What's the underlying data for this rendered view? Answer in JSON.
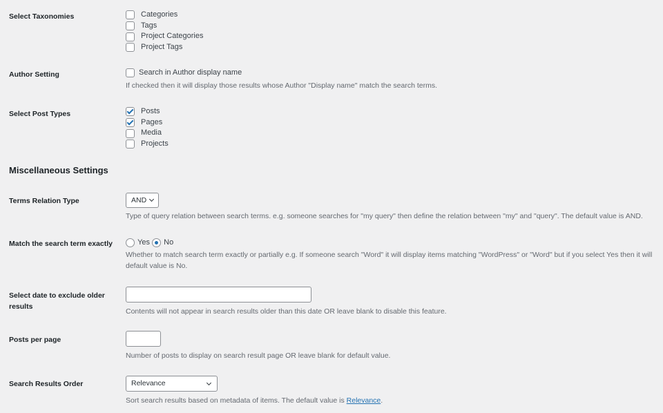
{
  "taxonomies": {
    "label": "Select Taxonomies",
    "options": [
      {
        "label": "Categories",
        "checked": false
      },
      {
        "label": "Tags",
        "checked": false
      },
      {
        "label": "Project Categories",
        "checked": false
      },
      {
        "label": "Project Tags",
        "checked": false
      }
    ]
  },
  "author": {
    "label": "Author Setting",
    "option": {
      "label": "Search in Author display name",
      "checked": false
    },
    "description": "If checked then it will display those results whose Author \"Display name\" match the search terms."
  },
  "post_types": {
    "label": "Select Post Types",
    "options": [
      {
        "label": "Posts",
        "checked": true
      },
      {
        "label": "Pages",
        "checked": true
      },
      {
        "label": "Media",
        "checked": false
      },
      {
        "label": "Projects",
        "checked": false
      }
    ]
  },
  "misc": {
    "title": "Miscellaneous Settings"
  },
  "terms_relation": {
    "label": "Terms Relation Type",
    "value": "AND",
    "description": "Type of query relation between search terms. e.g. someone searches for \"my query\" then define the relation between \"my\" and \"query\". The default value is AND."
  },
  "exact_match": {
    "label": "Match the search term exactly",
    "yes_label": "Yes",
    "no_label": "No",
    "selected": "No",
    "description_line1": "Whether to match search term exactly or partially e.g. If someone search \"Word\" it will display items matching \"WordPress\" or \"Word\" but if you select Yes then it will",
    "description_line2": "default value is No."
  },
  "exclude_date": {
    "label_line1": "Select date to exclude older",
    "label_line2": "results",
    "value": "",
    "description": "Contents will not appear in search results older than this date OR leave blank to disable this feature."
  },
  "posts_per_page": {
    "label": "Posts per page",
    "value": "",
    "description": "Number of posts to display on search result page OR leave blank for default value."
  },
  "results_order": {
    "label": "Search Results Order",
    "value": "Relevance",
    "description_prefix": "Sort search results based on metadata of items. The default value is ",
    "description_link": "Relevance",
    "description_suffix": "."
  }
}
